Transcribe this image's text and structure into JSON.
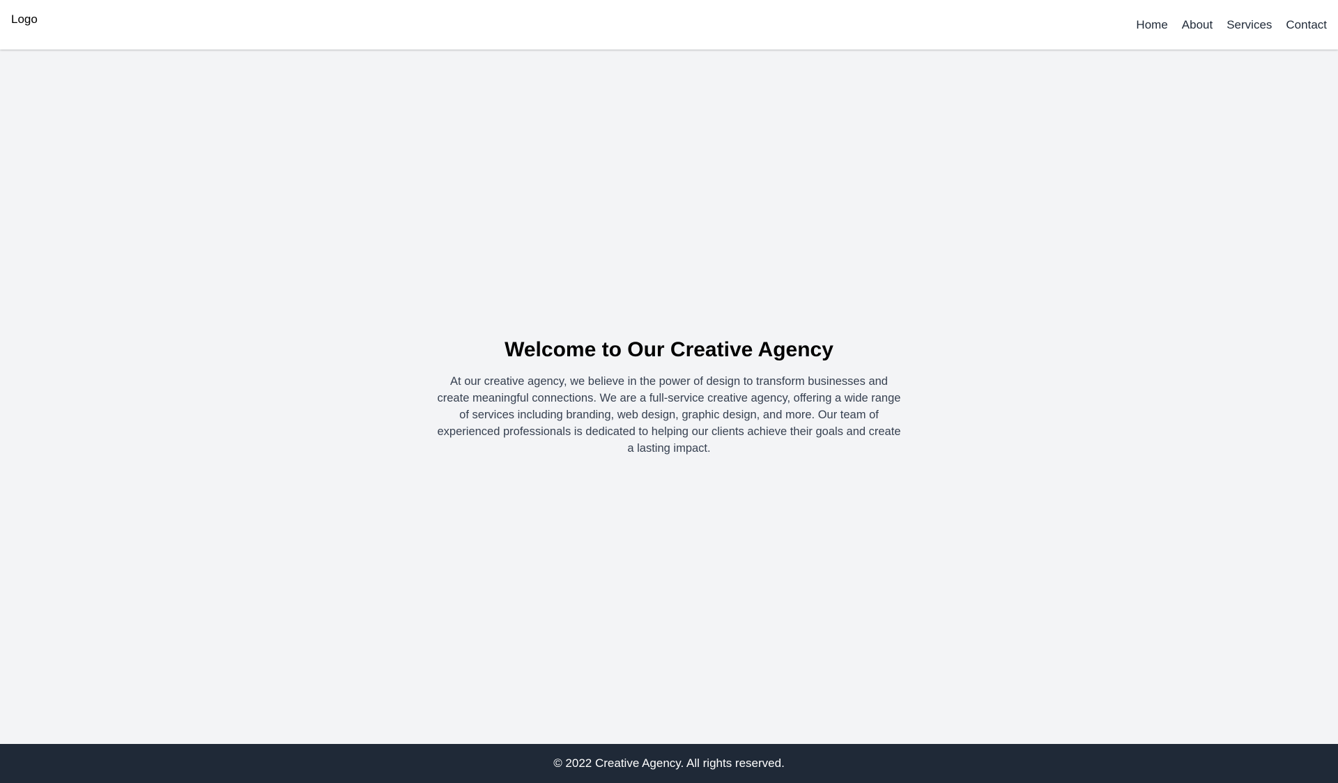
{
  "header": {
    "logo": "Logo",
    "nav": {
      "home": "Home",
      "about": "About",
      "services": "Services",
      "contact": "Contact"
    }
  },
  "hero": {
    "title": "Welcome to Our Creative Agency",
    "text": "At our creative agency, we believe in the power of design to transform businesses and create meaningful connections. We are a full-service creative agency, offering a wide range of services including branding, web design, graphic design, and more. Our team of experienced professionals is dedicated to helping our clients achieve their goals and create a lasting impact."
  },
  "footer": {
    "copyright": "© 2022 Creative Agency. All rights reserved."
  },
  "colors": {
    "page_background": "#f3f4f6",
    "header_background": "#ffffff",
    "footer_background": "#1f2937",
    "nav_text": "#1f2937",
    "body_text": "#374151"
  }
}
